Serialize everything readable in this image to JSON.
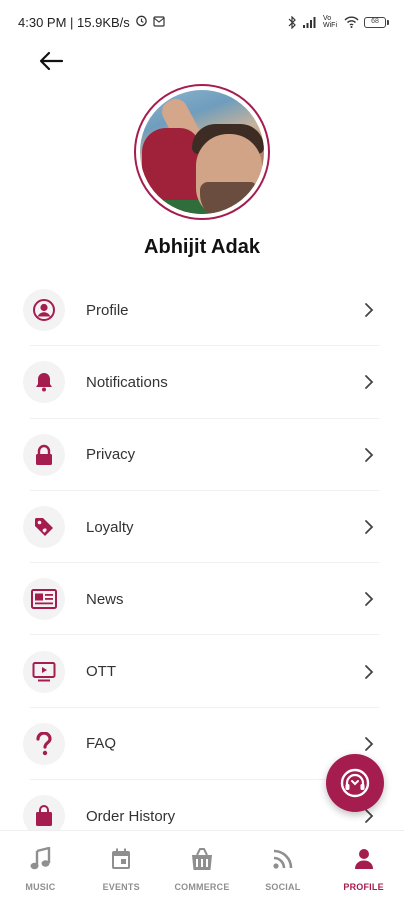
{
  "status_bar": {
    "time_speed": "4:30 PM | 15.9KB/s",
    "network": "Vo WiFi",
    "battery": "68"
  },
  "profile": {
    "name": "Abhijit Adak"
  },
  "menu": {
    "items": [
      {
        "label": "Profile",
        "icon": "user-circle-icon"
      },
      {
        "label": "Notifications",
        "icon": "bell-icon"
      },
      {
        "label": "Privacy",
        "icon": "lock-icon"
      },
      {
        "label": "Loyalty",
        "icon": "tag-icon"
      },
      {
        "label": "News",
        "icon": "newspaper-icon"
      },
      {
        "label": "OTT",
        "icon": "tv-play-icon"
      },
      {
        "label": "FAQ",
        "icon": "question-mark-icon"
      },
      {
        "label": "Order History",
        "icon": "shopping-bag-icon"
      }
    ]
  },
  "bottom_nav": {
    "items": [
      {
        "label": "MUSIC",
        "icon": "music-note-icon",
        "active": false
      },
      {
        "label": "EVENTS",
        "icon": "calendar-icon",
        "active": false
      },
      {
        "label": "COMMERCE",
        "icon": "storefront-icon",
        "active": false
      },
      {
        "label": "SOCIAL",
        "icon": "rss-icon",
        "active": false
      },
      {
        "label": "PROFILE",
        "icon": "person-icon",
        "active": true
      }
    ]
  },
  "colors": {
    "accent": "#a51d4f",
    "inactive_nav": "#8f8f8f",
    "icon_bg": "#f3f3f3"
  }
}
